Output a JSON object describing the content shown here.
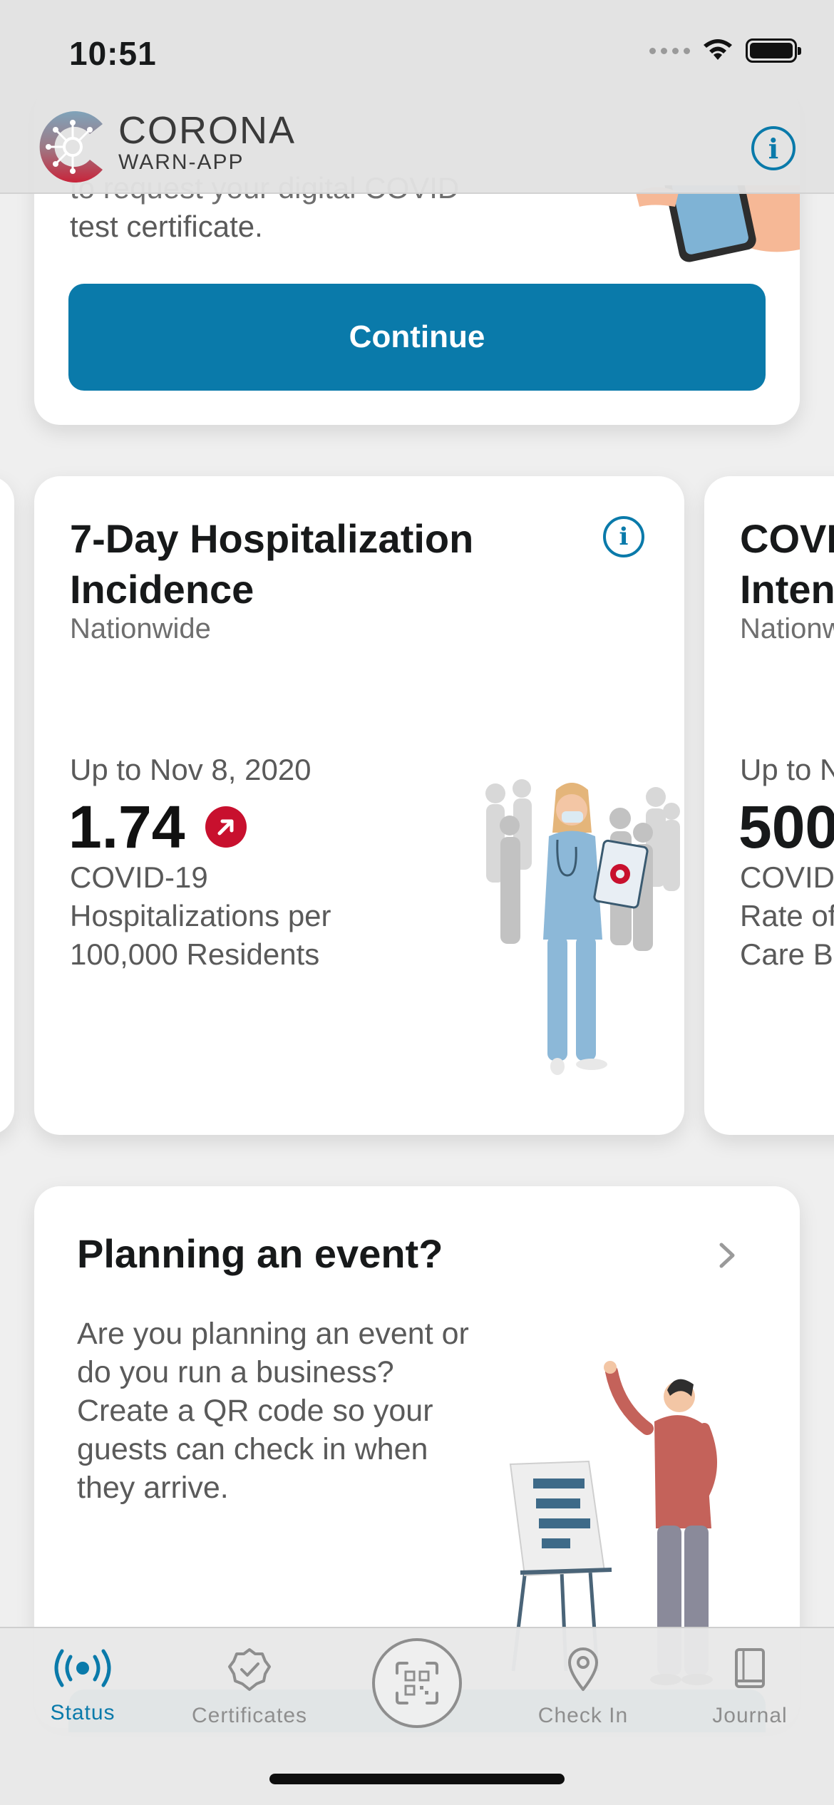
{
  "status_bar": {
    "time": "10:51"
  },
  "header": {
    "logo_line1": "CORONA",
    "logo_line2": "WARN-APP",
    "info_icon": "info-icon"
  },
  "certificate_card": {
    "text_cut": "to request your digital COVID",
    "text_line": "test certificate.",
    "continue_label": "Continue"
  },
  "stat_card": {
    "title": "7-Day Hospitalization Incidence",
    "subtitle": "Nationwide",
    "date": "Up to Nov 8, 2020",
    "value": "1.74",
    "trend": "increasing",
    "description": "COVID-19 Hospitalizations per 100,000 Residents"
  },
  "stat_card_next": {
    "title_line1": "COVI",
    "title_line2": "Inten",
    "subtitle": "Nationw",
    "date": "Up to N",
    "value": "500",
    "desc_line1": "COVID",
    "desc_line2": "Rate of",
    "desc_line3": "Care B"
  },
  "event_card": {
    "title": "Planning an event?",
    "body": "Are you planning an event or do you run a business? Create a QR code so your guests can check in when they arrive."
  },
  "tabbar": {
    "status": "Status",
    "certificates": "Certificates",
    "check_in": "Check In",
    "journal": "Journal",
    "active": "status"
  },
  "colors": {
    "accent": "#0a7aaa",
    "alert": "#c8102e",
    "background": "#efefef"
  }
}
